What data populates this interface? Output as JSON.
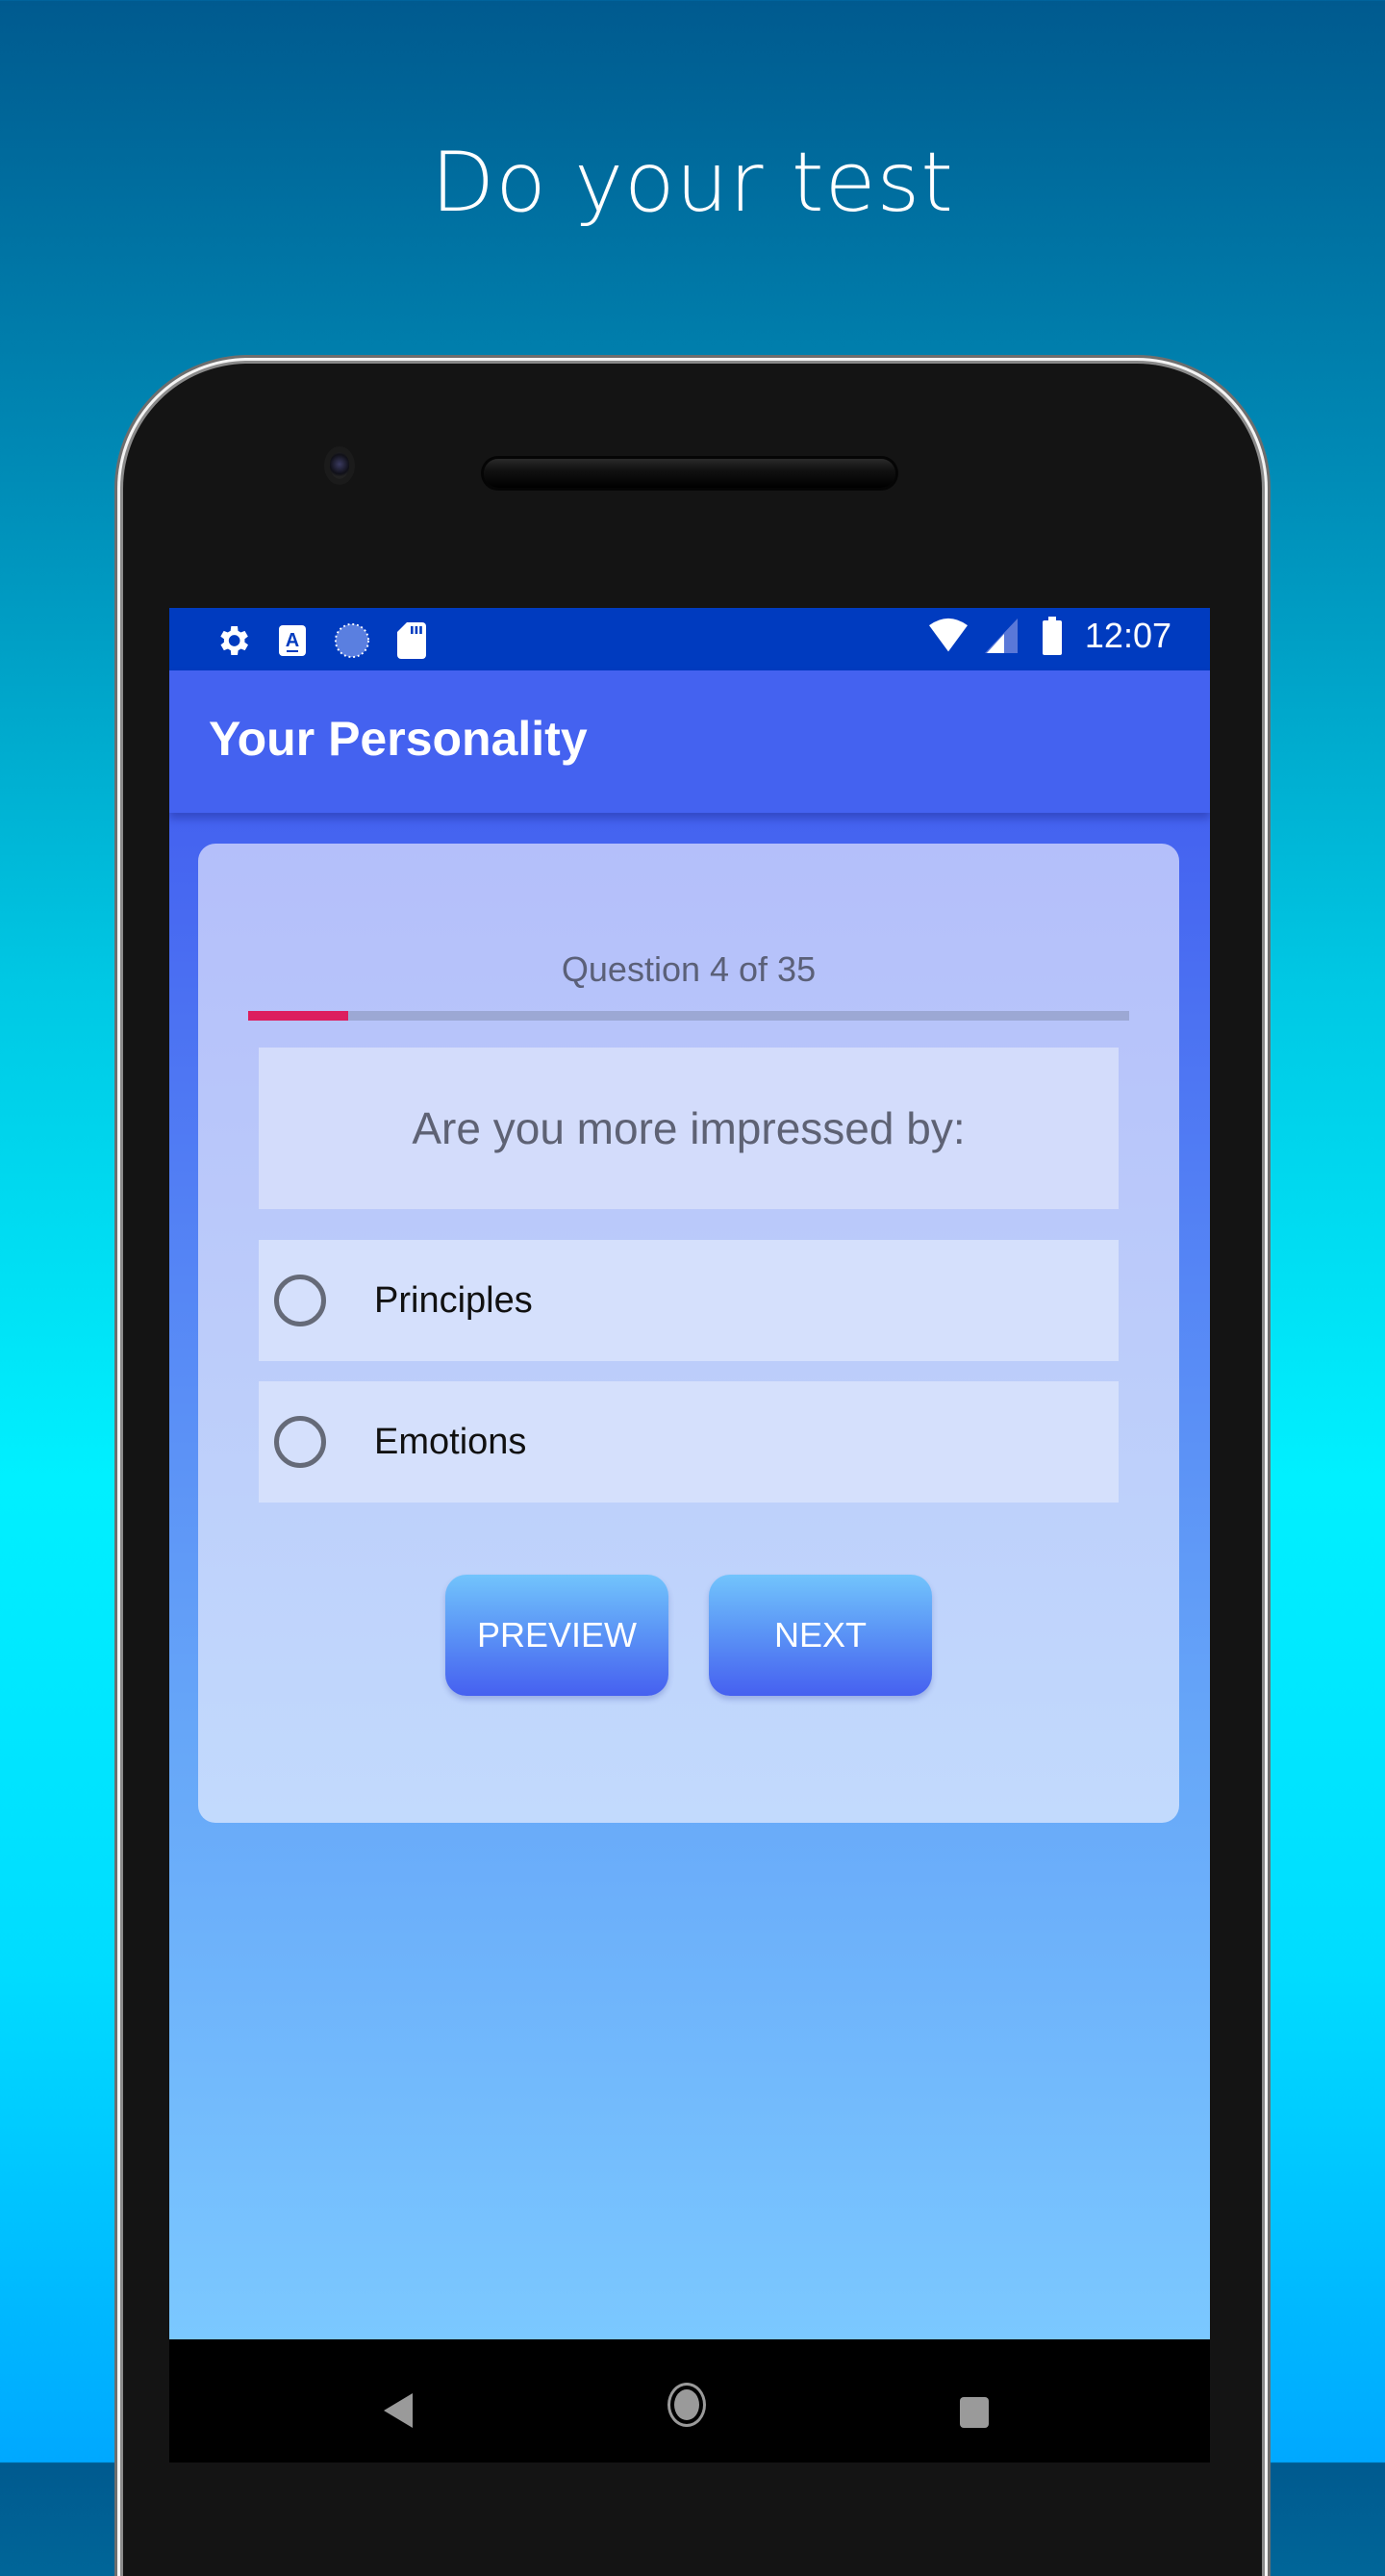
{
  "headline": "Do your test",
  "status_bar": {
    "left_icons": [
      "gear-icon",
      "accessibility-a-icon",
      "loading-circle-icon",
      "sd-card-icon"
    ],
    "right_icons": [
      "wifi-icon",
      "cell-signal-icon",
      "battery-icon"
    ],
    "time": "12:07"
  },
  "app_bar": {
    "title": "Your Personality"
  },
  "quiz": {
    "question_counter": "Question 4 of 35",
    "current_question": 4,
    "total_questions": 35,
    "progress_fraction": 0.114,
    "question_text": "Are you more impressed by:",
    "options": [
      {
        "label": "Principles",
        "selected": false
      },
      {
        "label": "Emotions",
        "selected": false
      }
    ],
    "preview_label": "PREVIEW",
    "next_label": "NEXT"
  },
  "colors": {
    "status_bar": "#003bbf",
    "app_bar": "#4462f0",
    "progress_fill": "#dc1e5e",
    "progress_track": "#9ca8d4"
  },
  "nav_bar": {
    "buttons": [
      "back-icon",
      "home-icon",
      "recents-icon"
    ]
  }
}
